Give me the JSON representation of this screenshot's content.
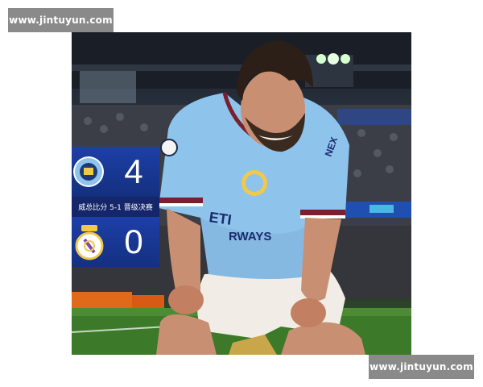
{
  "watermark": {
    "text": "www.jintuyun.com"
  },
  "score": {
    "home_score": "4",
    "away_score": "0",
    "aggregate_text": "威总比分 5-1 晋级决赛"
  },
  "crests": {
    "home_icon": "manchester-city-crest-icon",
    "away_icon": "real-madrid-crest-icon"
  },
  "jersey": {
    "sponsor_partial": "ETI",
    "sponsor_partial2": "RWAYS",
    "sleeve_partial": "NEX"
  },
  "colors": {
    "score_panel": "#1d3fa8",
    "jersey": "#8ec3ec",
    "pitch": "#3c7a2a"
  }
}
